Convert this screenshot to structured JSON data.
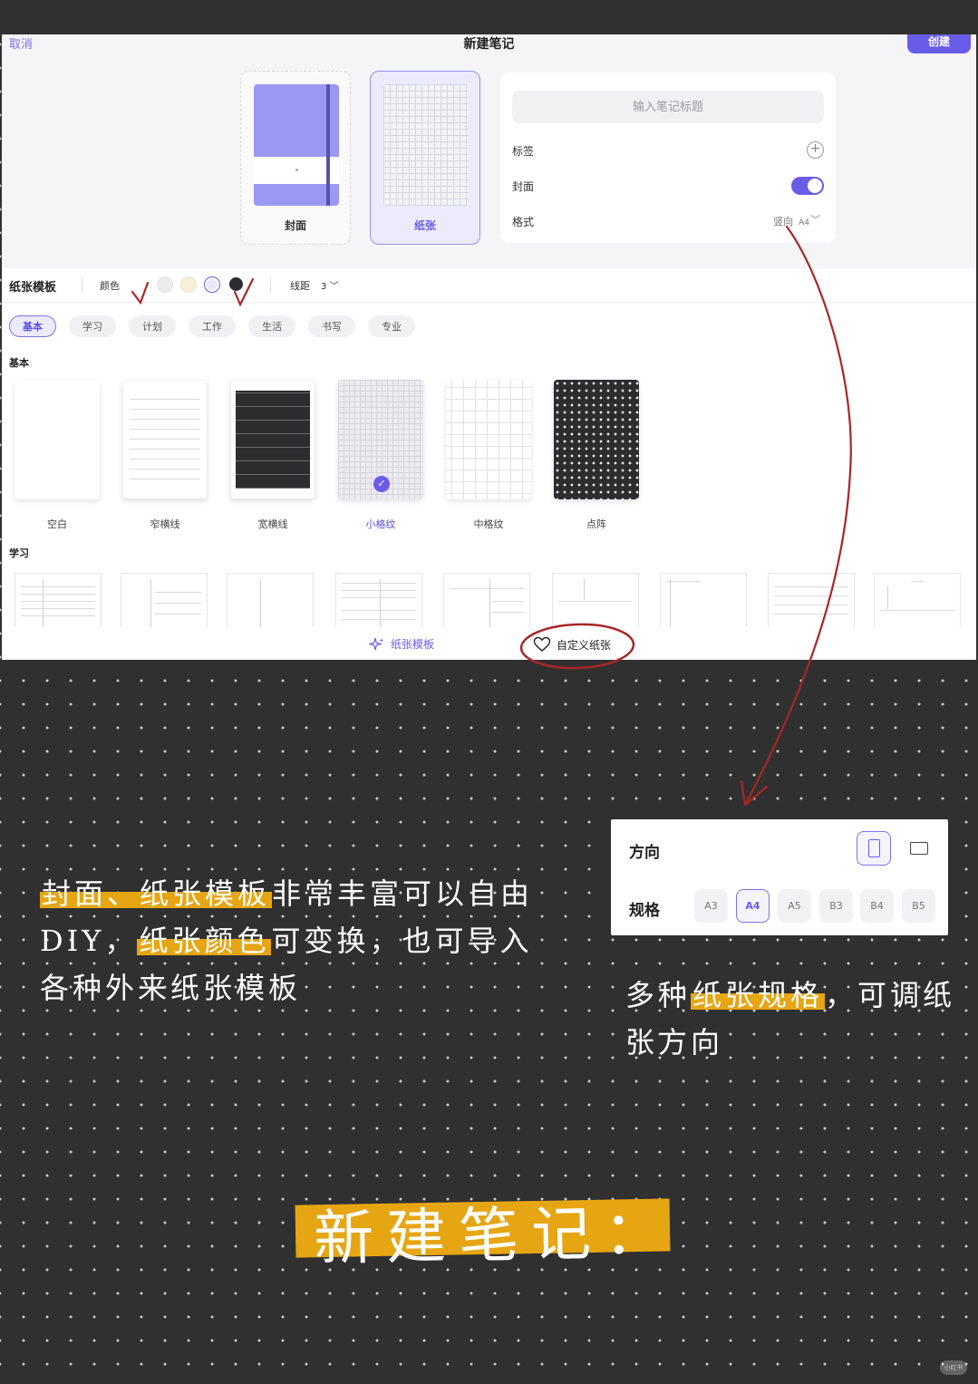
{
  "dialog": {
    "cancel": "取消",
    "title": "新建笔记",
    "create": "创建"
  },
  "cards": {
    "cover_label": "封面",
    "paper_label": "纸张"
  },
  "form": {
    "title_placeholder": "输入笔记标题",
    "tags_label": "标签",
    "cover_label": "封面",
    "cover_toggle_on": true,
    "format_label": "格式",
    "format_orientation": "竖向",
    "format_size": "A4"
  },
  "toolbar": {
    "title": "纸张模板",
    "color_label": "颜色",
    "swatches": [
      "#ececec",
      "#f6f1d6",
      "#e8e6fb",
      "#2d2d2f"
    ],
    "selected_swatch": 2,
    "spacing_label": "线距",
    "spacing_value": "3"
  },
  "tabs": [
    "基本",
    "学习",
    "计划",
    "工作",
    "生活",
    "书写",
    "专业"
  ],
  "active_tab": 0,
  "section_basic": "基本",
  "templates": [
    "空白",
    "窄横线",
    "宽横线",
    "小格纹",
    "中格纹",
    "点阵"
  ],
  "selected_template": 3,
  "section_study": "学习",
  "bottom_tabs": {
    "paper_template": "纸张模板",
    "custom_paper": "自定义纸张"
  },
  "popover": {
    "orientation_label": "方向",
    "size_label": "规格",
    "selected_orientation": "portrait",
    "sizes": [
      "A3",
      "A4",
      "A5",
      "B3",
      "B4",
      "B5"
    ],
    "selected_size": 1
  },
  "captions": {
    "left_hl1": "封面、纸张模板",
    "left_t1": "非常丰富可以自由DIY，",
    "left_hl2": "纸张颜色",
    "left_t2": "可变换，也可导入各种外来纸张模板",
    "right_t1": "多种",
    "right_hl": "纸张规格",
    "right_t2": "，可调纸张方向",
    "big_title": "新建笔记："
  },
  "watermark": "小红书",
  "colors": {
    "accent": "#6a5ce8",
    "highlight": "#e6a613",
    "background": "#303030",
    "annotation": "#a8262a"
  }
}
